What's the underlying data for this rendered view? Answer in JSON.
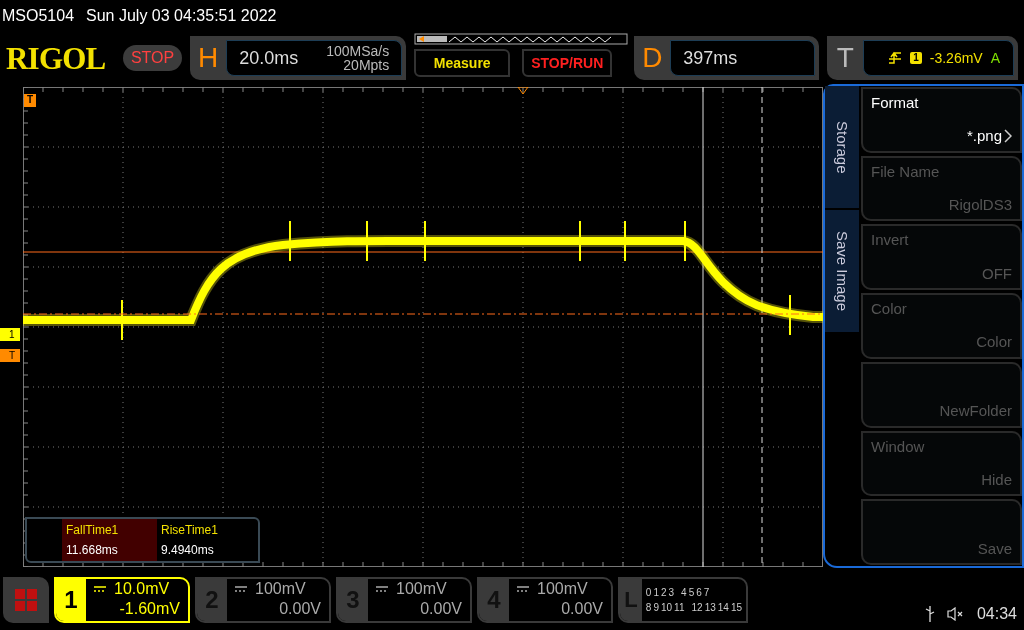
{
  "status_line": {
    "model": "MSO5104",
    "datetime": "Sun July 03 04:35:51 2022"
  },
  "brand": "RIGOL",
  "run_state": {
    "label": "STOP"
  },
  "horizontal": {
    "letter": "H",
    "timebase": "20.0ms",
    "sample_rate": "100MSa/s",
    "memory_depth": "20Mpts"
  },
  "buttons": [
    {
      "label": "Measure",
      "kind": "measure"
    },
    {
      "label": "STOP/RUN",
      "kind": "run"
    }
  ],
  "delay": {
    "letter": "D",
    "value": "397ms"
  },
  "trigger": {
    "letter": "T",
    "source": "1",
    "level": "-3.26mV",
    "mode": "A"
  },
  "screen_markers": {
    "trigger_top": "T",
    "channel": "1",
    "trigger_level": "T"
  },
  "measurements": [
    {
      "name": "FallTime1",
      "value": "11.668ms",
      "selected": true
    },
    {
      "name": "RiseTime1",
      "value": "9.4940ms",
      "selected": false
    }
  ],
  "side_menu": {
    "tabs": [
      {
        "label": "Storage"
      },
      {
        "label": "Save Image"
      }
    ],
    "items": [
      {
        "label": "Format",
        "value": "*.png",
        "enabled": true,
        "submenu": true
      },
      {
        "label": "File Name",
        "value": "RigolDS3",
        "enabled": false,
        "submenu": false
      },
      {
        "label": "Invert",
        "value": "OFF",
        "enabled": false,
        "submenu": false
      },
      {
        "label": "Color",
        "value": "Color",
        "enabled": false,
        "submenu": false
      },
      {
        "value": "NewFolder",
        "enabled": false,
        "submenu": false
      },
      {
        "label": "Window",
        "value": "Hide",
        "enabled": false,
        "submenu": false
      },
      {
        "value": "Save",
        "enabled": false,
        "submenu": false
      }
    ]
  },
  "channels": [
    {
      "number": "1",
      "scale": "10.0mV",
      "offset": "-1.60mV",
      "selected": true
    },
    {
      "number": "2",
      "scale": "100mV",
      "offset": "0.00V",
      "selected": false
    },
    {
      "number": "3",
      "scale": "100mV",
      "offset": "0.00V",
      "selected": false
    },
    {
      "number": "4",
      "scale": "100mV",
      "offset": "0.00V",
      "selected": false
    }
  ],
  "logic": {
    "letter": "L",
    "row_1": [
      "0",
      "1",
      "2",
      "3",
      "4",
      "5",
      "6",
      "7"
    ],
    "row_2": [
      "8",
      "9",
      "10",
      "11",
      "12",
      "13",
      "14",
      "15"
    ]
  },
  "status_bar": {
    "time": "04:34",
    "muted": true
  }
}
